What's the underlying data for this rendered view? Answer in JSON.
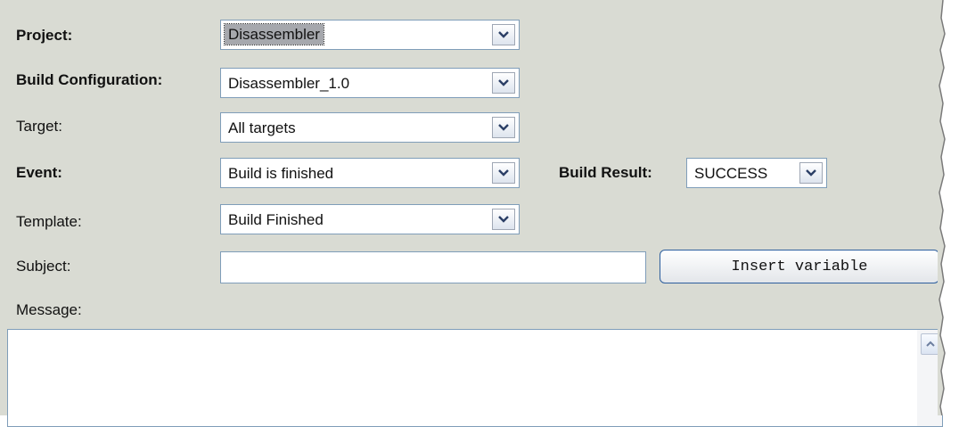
{
  "form": {
    "project": {
      "label": "Project:",
      "value": "Disassembler"
    },
    "build_configuration": {
      "label": "Build Configuration:",
      "value": "Disassembler_1.0"
    },
    "target": {
      "label": "Target:",
      "value": "All targets"
    },
    "event": {
      "label": "Event:",
      "value": "Build is finished"
    },
    "build_result": {
      "label": "Build Result:",
      "value": "SUCCESS"
    },
    "template": {
      "label": "Template:",
      "value": "Build Finished"
    },
    "subject": {
      "label": "Subject:",
      "value": ""
    },
    "insert_variable_label": "Insert variable",
    "message": {
      "label": "Message:",
      "value": ""
    }
  },
  "icons": {
    "dropdown": "chevron-down-icon",
    "scroll_up": "chevron-up-icon"
  },
  "colors": {
    "panel_bg": "#d9dbd3",
    "field_border": "#7f9db9",
    "button_border": "#2d5f9e",
    "selected_bg": "#a6a8ad"
  }
}
